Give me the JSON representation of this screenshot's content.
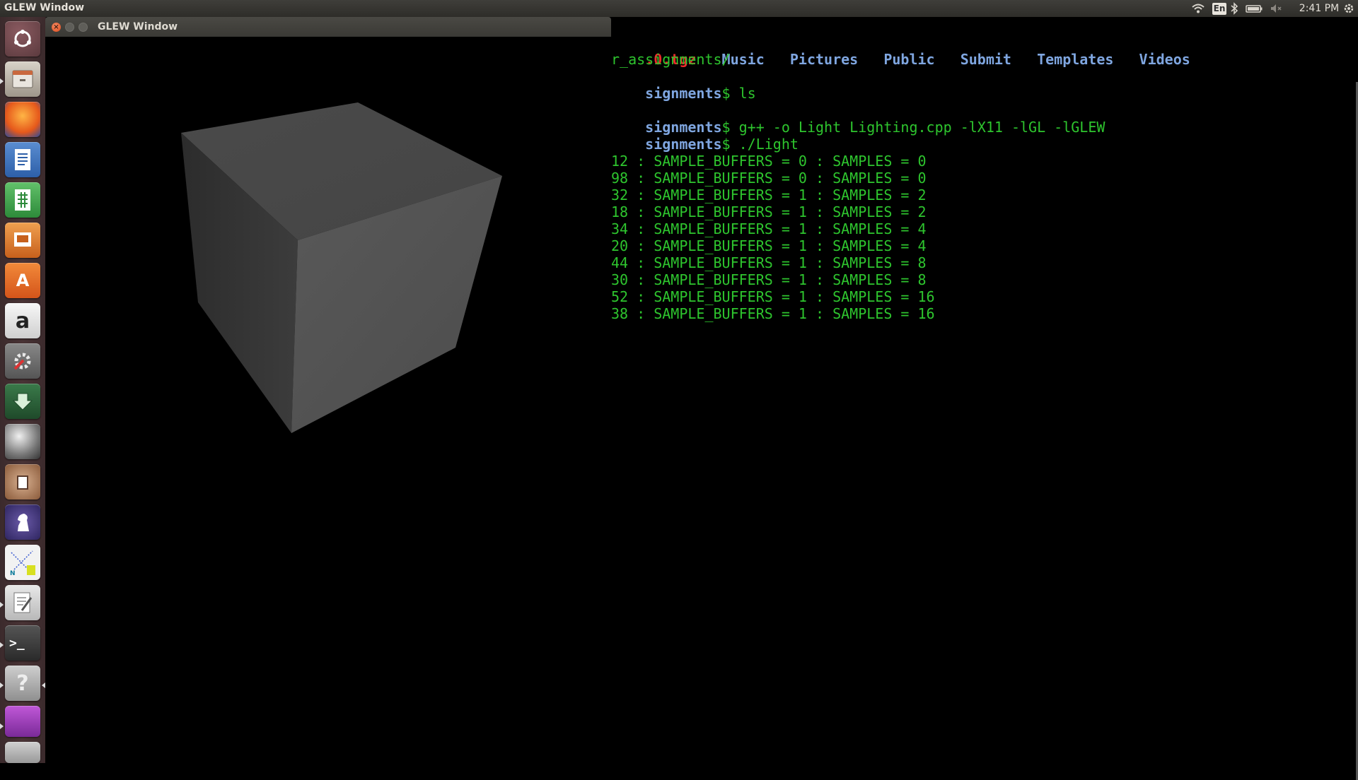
{
  "top_panel": {
    "app_title": "GLEW Window",
    "keyboard_layout": "En",
    "clock": "2:41 PM",
    "icons": [
      "wifi-icon",
      "keyboard-layout-indicator",
      "bluetooth-icon",
      "battery-icon",
      "volume-muted-icon",
      "system-gear-icon"
    ]
  },
  "launcher": {
    "items": [
      {
        "name": "dash-home",
        "glyph": ""
      },
      {
        "name": "files",
        "glyph": ""
      },
      {
        "name": "firefox",
        "glyph": ""
      },
      {
        "name": "libreoffice-writer",
        "glyph": ""
      },
      {
        "name": "libreoffice-calc",
        "glyph": ""
      },
      {
        "name": "libreoffice-impress",
        "glyph": ""
      },
      {
        "name": "software-center",
        "glyph": "A"
      },
      {
        "name": "amazon",
        "glyph": "a"
      },
      {
        "name": "system-settings",
        "glyph": ""
      },
      {
        "name": "installer",
        "glyph": ""
      },
      {
        "name": "disk-utility",
        "glyph": ""
      },
      {
        "name": "app-generic",
        "glyph": ""
      },
      {
        "name": "chess",
        "glyph": ""
      },
      {
        "name": "numbers",
        "glyph": ""
      },
      {
        "name": "text-editor",
        "glyph": ""
      },
      {
        "name": "terminal",
        "glyph": ">_"
      },
      {
        "name": "help",
        "glyph": "?"
      },
      {
        "name": "workspace-switcher",
        "glyph": ""
      }
    ]
  },
  "glew_window": {
    "title": "GLEW Window"
  },
  "terminal": {
    "line1": {
      "red": ".0.tgz",
      "dirs": "Music   Pictures   Public   Submit   Templates   Videos"
    },
    "line2": "r_assignments/",
    "prompt_path": "signments",
    "prompt_sign": "$",
    "cmd1": " ls",
    "cmd2": " g++ -o Light Lighting.cpp -lX11 -lGL -lGLEW",
    "cmd3": " ./Light",
    "output": [
      "12 : SAMPLE_BUFFERS = 0 : SAMPLES = 0",
      "98 : SAMPLE_BUFFERS = 0 : SAMPLES = 0",
      "32 : SAMPLE_BUFFERS = 1 : SAMPLES = 2",
      "18 : SAMPLE_BUFFERS = 1 : SAMPLES = 2",
      "34 : SAMPLE_BUFFERS = 1 : SAMPLES = 4",
      "20 : SAMPLE_BUFFERS = 1 : SAMPLES = 4",
      "44 : SAMPLE_BUFFERS = 1 : SAMPLES = 8",
      "30 : SAMPLE_BUFFERS = 1 : SAMPLES = 8",
      "52 : SAMPLE_BUFFERS = 1 : SAMPLES = 16",
      "38 : SAMPLE_BUFFERS = 1 : SAMPLES = 16"
    ]
  },
  "colors": {
    "terminal_green": "#2ec52e",
    "dir_blue": "#7fa6e0",
    "archive_red": "#ee2b2b",
    "cube_gray": "#4a4a4a"
  }
}
